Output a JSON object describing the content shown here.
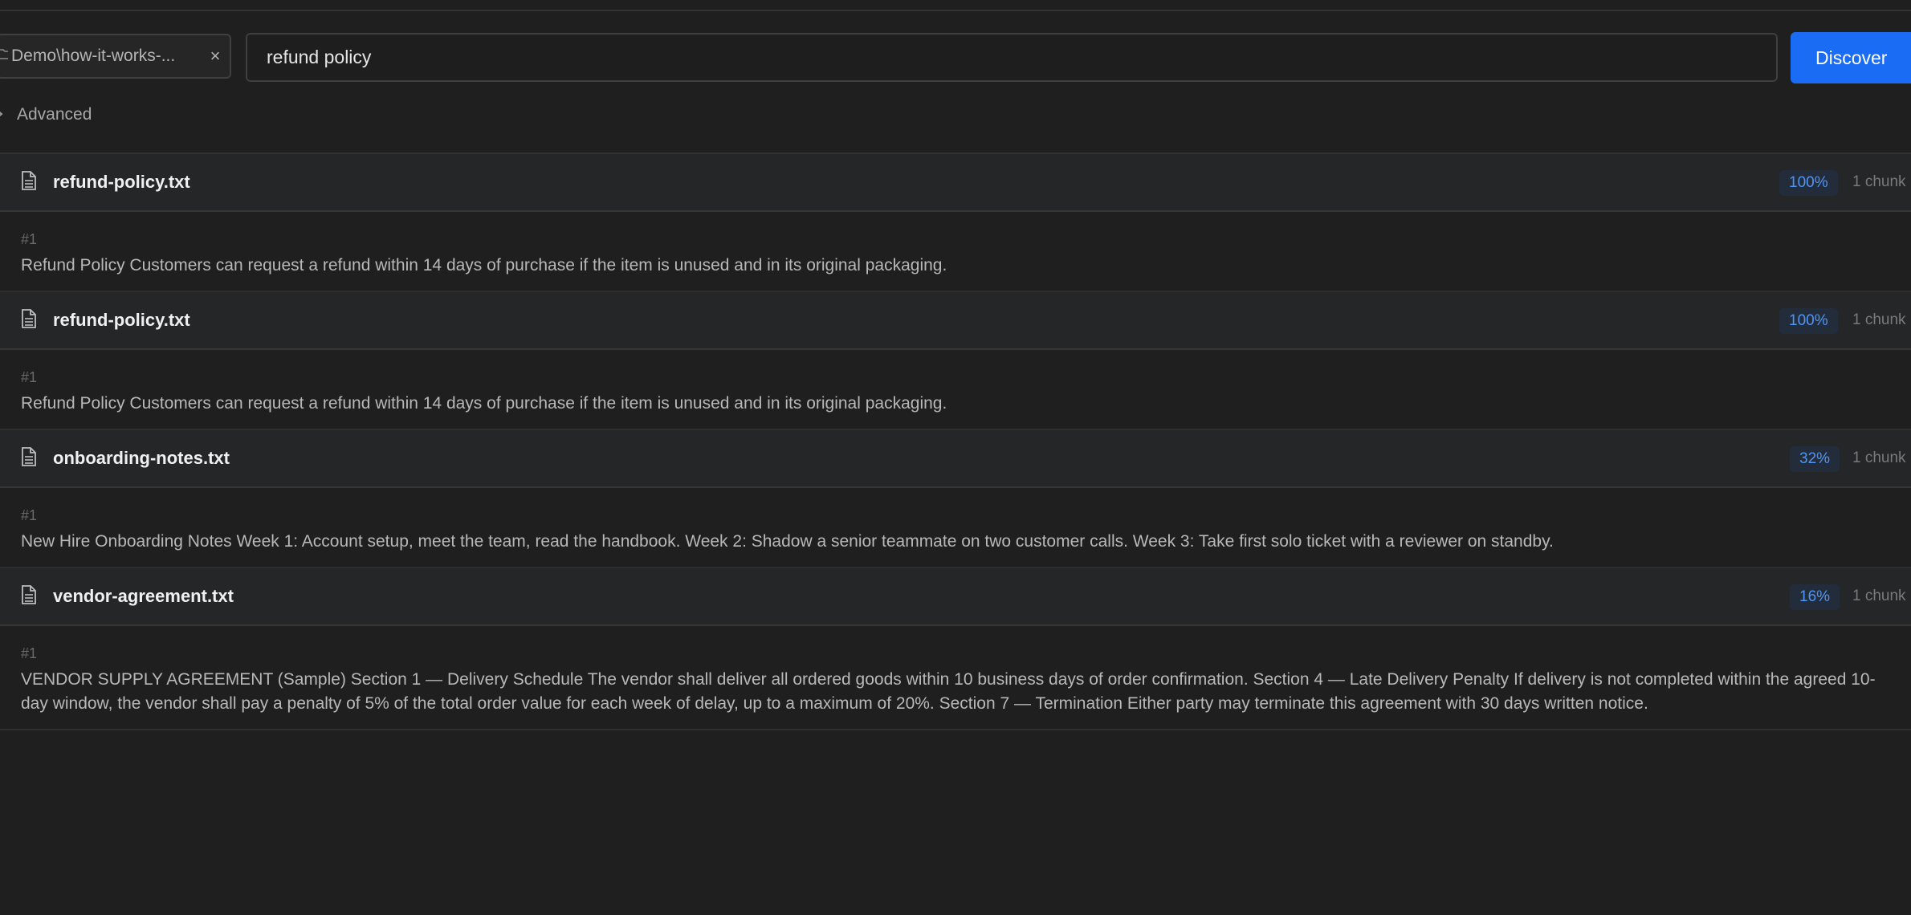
{
  "search_bar": {
    "scope_chip": {
      "label": "Demo\\how-it-works-...",
      "icon": "folder-icon",
      "close_glyph": "×"
    },
    "query_value": "refund policy",
    "discover_label": "Discover"
  },
  "advanced": {
    "label": "Advanced",
    "expanded": false
  },
  "results": [
    {
      "file_name": "refund-policy.txt",
      "score": "100%",
      "chunk_count": "1 chunk",
      "chunks": [
        {
          "index": "#1",
          "text": "Refund Policy Customers can request a refund within 14 days of purchase if the item is unused and in its original packaging."
        }
      ]
    },
    {
      "file_name": "refund-policy.txt",
      "score": "100%",
      "chunk_count": "1 chunk",
      "chunks": [
        {
          "index": "#1",
          "text": "Refund Policy Customers can request a refund within 14 days of purchase if the item is unused and in its original packaging."
        }
      ]
    },
    {
      "file_name": "onboarding-notes.txt",
      "score": "32%",
      "chunk_count": "1 chunk",
      "chunks": [
        {
          "index": "#1",
          "text": "New Hire Onboarding Notes Week 1: Account setup, meet the team, read the handbook. Week 2: Shadow a senior teammate on two customer calls. Week 3: Take first solo ticket with a reviewer on standby."
        }
      ]
    },
    {
      "file_name": "vendor-agreement.txt",
      "score": "16%",
      "chunk_count": "1 chunk",
      "chunks": [
        {
          "index": "#1",
          "text": "VENDOR SUPPLY AGREEMENT (Sample) Section 1 — Delivery Schedule The vendor shall deliver all ordered goods within 10 business days of order confirmation. Section 4 — Late Delivery Penalty If delivery is not completed within the agreed 10-day window, the vendor shall pay a penalty of 5% of the total order value for each week of delay, up to a maximum of 20%. Section 7 — Termination Either party may terminate this agreement with 30 days written notice."
        }
      ]
    }
  ],
  "colors": {
    "background": "#1f1f1f",
    "accent": "#1a6cf5",
    "score_text": "#4f95f5",
    "score_bg": "#232c3b"
  }
}
